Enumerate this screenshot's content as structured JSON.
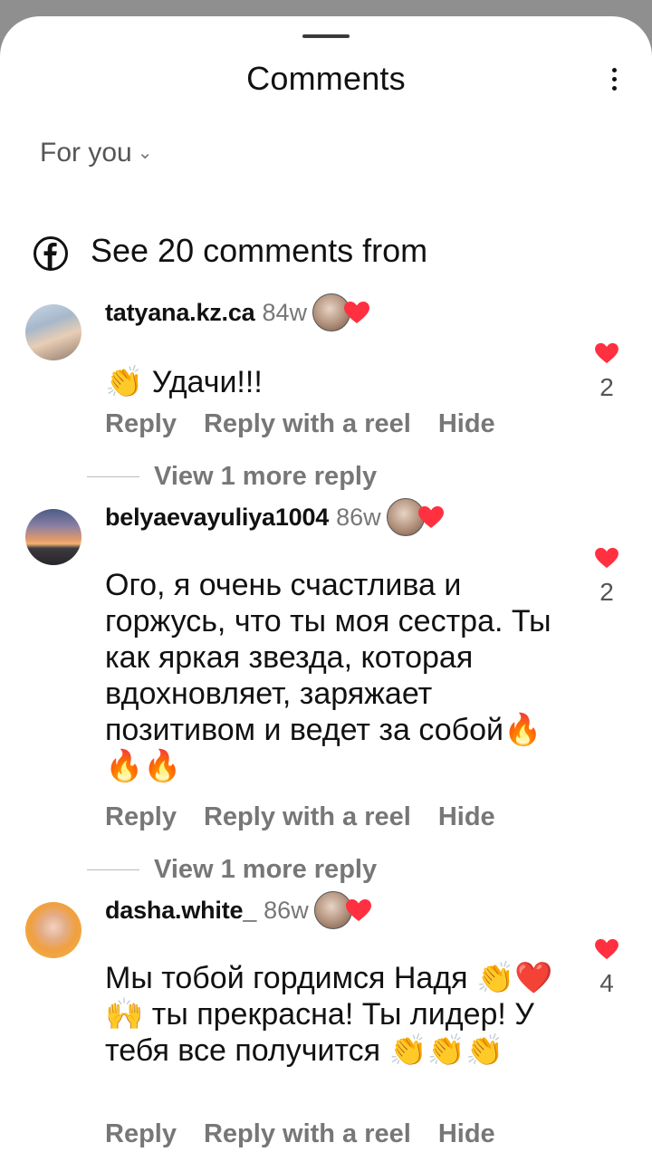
{
  "header": {
    "title": "Comments"
  },
  "filter": {
    "label": "For you"
  },
  "facebook_row": {
    "text": "See 20 comments from"
  },
  "comments": [
    {
      "username": "tatyana.kz.ca",
      "time": "84w",
      "text": "👏 Удачи!!!",
      "likes": "2",
      "actions": [
        "Reply",
        "Reply with a reel",
        "Hide"
      ],
      "view_more": "View 1 more reply"
    },
    {
      "username": "belyaevayuliya1004",
      "time": "86w",
      "text": "Ого, я очень счастлива и горжусь, что ты моя сестра. Ты как яркая звезда, которая вдохновляет, заряжает позитивом и  ведет за собой🔥🔥🔥",
      "likes": "2",
      "actions": [
        "Reply",
        "Reply with a reel",
        "Hide"
      ],
      "view_more": "View 1 more reply"
    },
    {
      "username": "dasha.white_",
      "time": "86w",
      "text": "Мы тобой гордимся Надя 👏❤️🙌 ты прекрасна! Ты лидер! У тебя все получится 👏👏👏",
      "likes": "4",
      "actions": [
        "Reply",
        "Reply with a reel",
        "Hide"
      ]
    }
  ],
  "colors": {
    "heart": "#ff3040",
    "muted": "#777777",
    "text": "#111111"
  }
}
